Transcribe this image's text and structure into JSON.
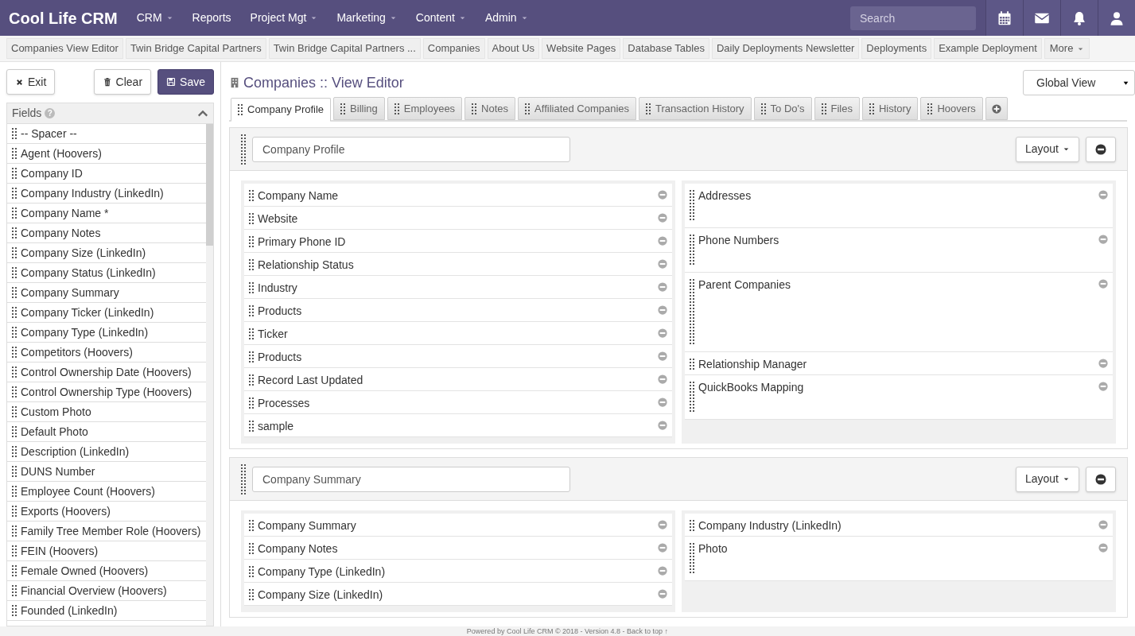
{
  "brand": "Cool Life CRM",
  "nav": [
    {
      "label": "CRM",
      "dropdown": true
    },
    {
      "label": "Reports",
      "dropdown": false
    },
    {
      "label": "Project Mgt",
      "dropdown": true
    },
    {
      "label": "Marketing",
      "dropdown": true
    },
    {
      "label": "Content",
      "dropdown": true
    },
    {
      "label": "Admin",
      "dropdown": true
    }
  ],
  "search": {
    "placeholder": "Search"
  },
  "recent": [
    "Companies View Editor",
    "Twin Bridge Capital Partners",
    "Twin Bridge Capital Partners ...",
    "Companies",
    "About Us",
    "Website Pages",
    "Database Tables",
    "Daily Deployments Newsletter",
    "Deployments",
    "Example Deployment"
  ],
  "recent_more": "More",
  "buttons": {
    "exit": "Exit",
    "clear": "Clear",
    "save": "Save"
  },
  "fields": {
    "title": "Fields",
    "help": "?",
    "expanded": true,
    "items": [
      "-- Spacer --",
      "Agent (Hoovers)",
      "Company ID",
      "Company Industry (LinkedIn)",
      "Company Name *",
      "Company Notes",
      "Company Size (LinkedIn)",
      "Company Status (LinkedIn)",
      "Company Summary",
      "Company Ticker (LinkedIn)",
      "Company Type (LinkedIn)",
      "Competitors (Hoovers)",
      "Control Ownership Date (Hoovers)",
      "Control Ownership Type (Hoovers)",
      "Custom Photo",
      "Default Photo",
      "Description (LinkedIn)",
      "DUNS Number",
      "Employee Count (Hoovers)",
      "Exports (Hoovers)",
      "Family Tree Member Role (Hoovers)",
      "FEIN (Hoovers)",
      "Female Owned (Hoovers)",
      "Financial Overview (Hoovers)",
      "Founded (LinkedIn)"
    ]
  },
  "page_title": "Companies :: View Editor",
  "view_select": "Global View",
  "tabs": [
    {
      "label": "Company Profile",
      "selected": true
    },
    {
      "label": "Billing",
      "selected": false
    },
    {
      "label": "Employees",
      "selected": false
    },
    {
      "label": "Notes",
      "selected": false
    },
    {
      "label": "Affiliated Companies",
      "selected": false
    },
    {
      "label": "Transaction History",
      "selected": false
    },
    {
      "label": "To Do's",
      "selected": false
    },
    {
      "label": "Files",
      "selected": false
    },
    {
      "label": "History",
      "selected": false
    },
    {
      "label": "Hoovers",
      "selected": false
    }
  ],
  "sections": [
    {
      "name": "Company Profile",
      "layout_button": "Layout",
      "left": [
        {
          "label": "Company Name",
          "kind": "short"
        },
        {
          "label": "Website",
          "kind": "short"
        },
        {
          "label": "Primary Phone ID",
          "kind": "short"
        },
        {
          "label": "Relationship Status",
          "kind": "short"
        },
        {
          "label": "Industry",
          "kind": "short"
        },
        {
          "label": "Products",
          "kind": "short"
        },
        {
          "label": "Ticker",
          "kind": "short"
        },
        {
          "label": "Products",
          "kind": "short"
        },
        {
          "label": "Record Last Updated",
          "kind": "short"
        },
        {
          "label": "Processes",
          "kind": "short"
        },
        {
          "label": "sample",
          "kind": "short"
        }
      ],
      "right": [
        {
          "label": "Addresses",
          "kind": "medium"
        },
        {
          "label": "Phone Numbers",
          "kind": "medium"
        },
        {
          "label": "Parent Companies",
          "kind": "tall"
        },
        {
          "label": "Relationship Manager",
          "kind": "short"
        },
        {
          "label": "QuickBooks Mapping",
          "kind": "medium"
        }
      ]
    },
    {
      "name": "Company Summary",
      "layout_button": "Layout",
      "left": [
        {
          "label": "Company Summary",
          "kind": "short"
        },
        {
          "label": "Company Notes",
          "kind": "short"
        },
        {
          "label": "Company Type (LinkedIn)",
          "kind": "short"
        },
        {
          "label": "Company Size (LinkedIn)",
          "kind": "short"
        }
      ],
      "right": [
        {
          "label": "Company Industry (LinkedIn)",
          "kind": "short"
        },
        {
          "label": "Photo",
          "kind": "medium"
        }
      ]
    }
  ],
  "footer": "Powered by Cool Life CRM © 2018 - Version 4.8 - Back to top ↑"
}
